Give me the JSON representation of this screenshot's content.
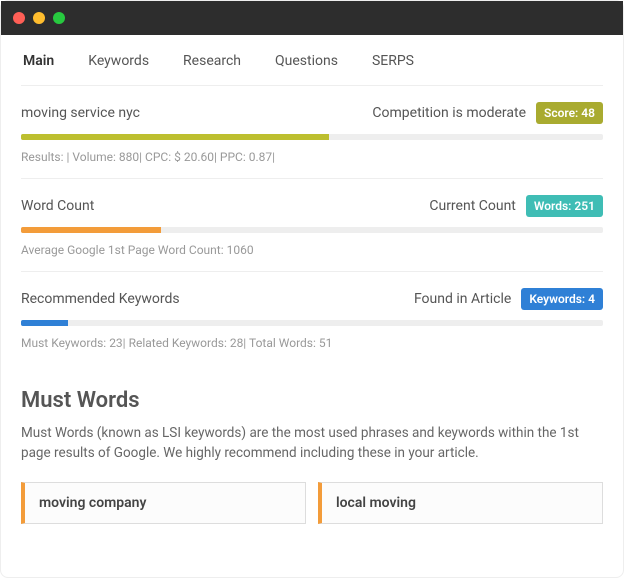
{
  "tabs": [
    "Main",
    "Keywords",
    "Research",
    "Questions",
    "SERPS"
  ],
  "active_tab": 0,
  "sections": {
    "competition": {
      "keyword": "moving service nyc",
      "label": "Competition is moderate",
      "badge": "Score: 48",
      "meta": "Results: | Volume: 880| CPC: $ 20.60| PPC: 0.87|"
    },
    "wordcount": {
      "title": "Word Count",
      "label": "Current Count",
      "badge": "Words: 251",
      "meta": "Average Google 1st Page Word Count: 1060"
    },
    "keywords": {
      "title": "Recommended Keywords",
      "label": "Found in Article",
      "badge": "Keywords: 4",
      "meta": "Must Keywords: 23| Related Keywords: 28| Total Words: 51"
    }
  },
  "must": {
    "heading": "Must Words",
    "description": "Must Words (known as LSI keywords) are the most used phrases and keywords within the 1st page results of Google. We highly recommend including these in your article.",
    "items": [
      "moving company",
      "local moving"
    ]
  }
}
